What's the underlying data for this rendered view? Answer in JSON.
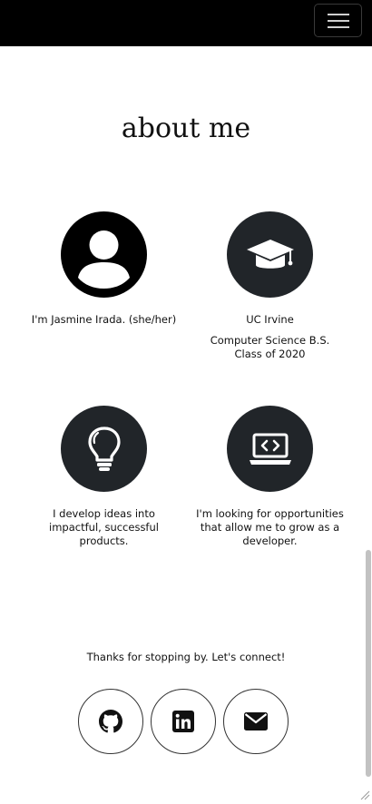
{
  "nav": {
    "menu_icon": "hamburger-icon"
  },
  "about": {
    "title": "about me",
    "cards": [
      {
        "icon": "user-avatar-icon",
        "lines": [
          "I'm Jasmine Irada. (she/her)"
        ]
      },
      {
        "icon": "graduation-cap-icon",
        "lines": [
          "UC Irvine",
          "Computer Science B.S.",
          "Class of 2020"
        ]
      },
      {
        "icon": "lightbulb-icon",
        "lines": [
          "I develop ideas into",
          "impactful, successful",
          "products."
        ]
      },
      {
        "icon": "laptop-code-icon",
        "lines": [
          "I'm looking for opportunities",
          "that allow me to grow as a",
          "developer."
        ]
      }
    ]
  },
  "connect": {
    "message": "Thanks for stopping by. Let's connect!",
    "links": [
      {
        "icon": "github-icon"
      },
      {
        "icon": "linkedin-icon"
      },
      {
        "icon": "email-icon"
      }
    ]
  },
  "colors": {
    "nav_bg": "#000000",
    "icon_circle": "#212529",
    "avatar": "#000000"
  }
}
